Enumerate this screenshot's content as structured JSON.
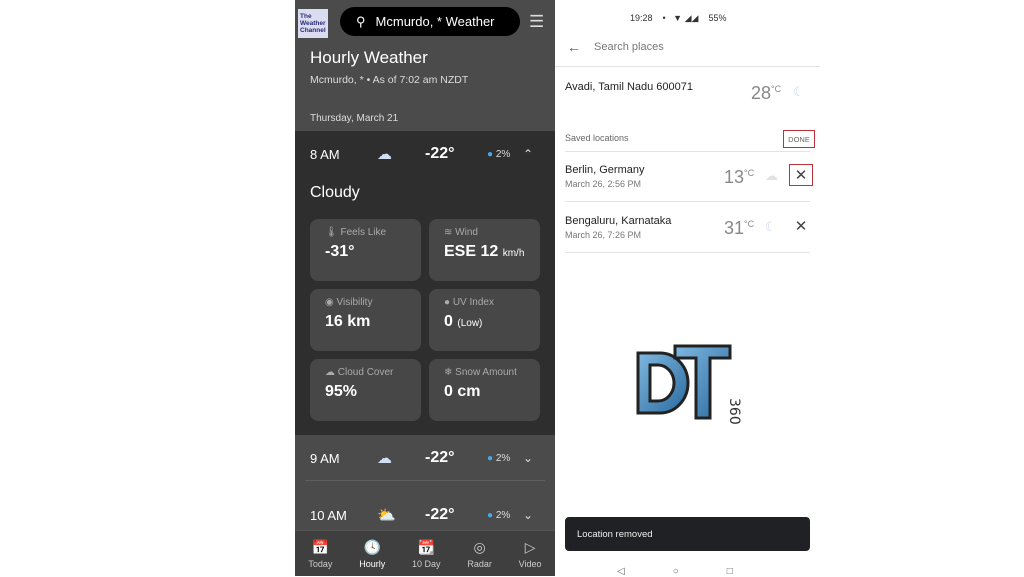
{
  "weather_app": {
    "logo_text": "The Weather Channel",
    "search_value": "Mcmurdo, * Weather",
    "title": "Hourly Weather",
    "subtitle": "Mcmurdo, * • As of 7:02 am NZDT",
    "date": "Thursday, March 21",
    "hours": [
      {
        "time": "8 AM",
        "icon": "cloud-icon",
        "temp": "-22°",
        "precip": "2%",
        "expanded": true
      },
      {
        "time": "9 AM",
        "icon": "cloud-icon",
        "temp": "-22°",
        "precip": "2%",
        "expanded": false
      },
      {
        "time": "10 AM",
        "icon": "partly-sunny-icon",
        "temp": "-22°",
        "precip": "2%",
        "expanded": false
      }
    ],
    "condition": "Cloudy",
    "details": [
      {
        "label": "Feels Like",
        "value": "-31°",
        "unit": "",
        "icon": "thermometer-icon"
      },
      {
        "label": "Wind",
        "value": "ESE 12",
        "unit": "km/h",
        "icon": "wind-icon"
      },
      {
        "label": "Visibility",
        "value": "16 km",
        "unit": "",
        "icon": "eye-icon"
      },
      {
        "label": "UV Index",
        "value": "0",
        "unit": "(Low)",
        "icon": "uv-icon"
      },
      {
        "label": "Cloud Cover",
        "value": "95%",
        "unit": "",
        "icon": "cloud-icon"
      },
      {
        "label": "Snow Amount",
        "value": "0 cm",
        "unit": "",
        "icon": "snowflake-icon"
      }
    ],
    "nav": [
      {
        "label": "Today",
        "badge": "20"
      },
      {
        "label": "Hourly"
      },
      {
        "label": "10 Day"
      },
      {
        "label": "Radar"
      },
      {
        "label": "Video"
      }
    ],
    "nav_active": "Hourly"
  },
  "places": {
    "status": {
      "time": "19:28",
      "battery": "55%"
    },
    "search_placeholder": "Search places",
    "current": {
      "name": "Avadi, Tamil Nadu 600071",
      "temp": "28",
      "unit": "°C"
    },
    "saved_label": "Saved locations",
    "done_label": "DONE",
    "saved": [
      {
        "name": "Berlin, Germany",
        "date": "March 26, 2:56 PM",
        "temp": "13",
        "unit": "°C"
      },
      {
        "name": "Bengaluru, Karnataka",
        "date": "March 26, 7:26 PM",
        "temp": "31",
        "unit": "°C"
      }
    ],
    "toast": "Location removed",
    "highlight_color": "#c0303a"
  },
  "watermark": {
    "text": "DTF 360"
  }
}
